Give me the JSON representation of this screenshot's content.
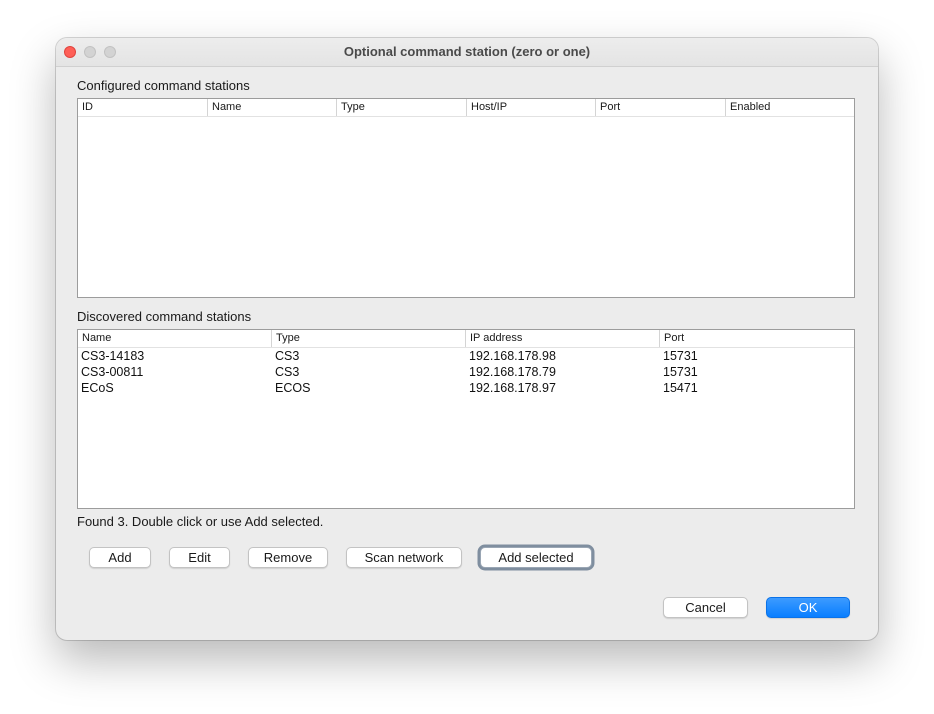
{
  "window": {
    "title": "Optional command station (zero or one)"
  },
  "configured": {
    "label": "Configured command stations",
    "columns": [
      "ID",
      "Name",
      "Type",
      "Host/IP",
      "Port",
      "Enabled"
    ],
    "rows": []
  },
  "discovered": {
    "label": "Discovered command stations",
    "columns": [
      "Name",
      "Type",
      "IP address",
      "Port"
    ],
    "rows": [
      [
        "CS3-14183",
        "CS3",
        "192.168.178.98",
        "15731"
      ],
      [
        "CS3-00811",
        "CS3",
        "192.168.178.79",
        "15731"
      ],
      [
        "ECoS",
        "ECOS",
        "192.168.178.97",
        "15471"
      ]
    ]
  },
  "status": "Found 3. Double click or use Add selected.",
  "buttons": {
    "add": "Add",
    "edit": "Edit",
    "remove": "Remove",
    "scan": "Scan network",
    "add_selected": "Add selected",
    "cancel": "Cancel",
    "ok": "OK"
  },
  "colors": {
    "close_button": "#fe5f57",
    "default_button": "#0a84ff",
    "focus_ring": "#7f8e9f"
  }
}
